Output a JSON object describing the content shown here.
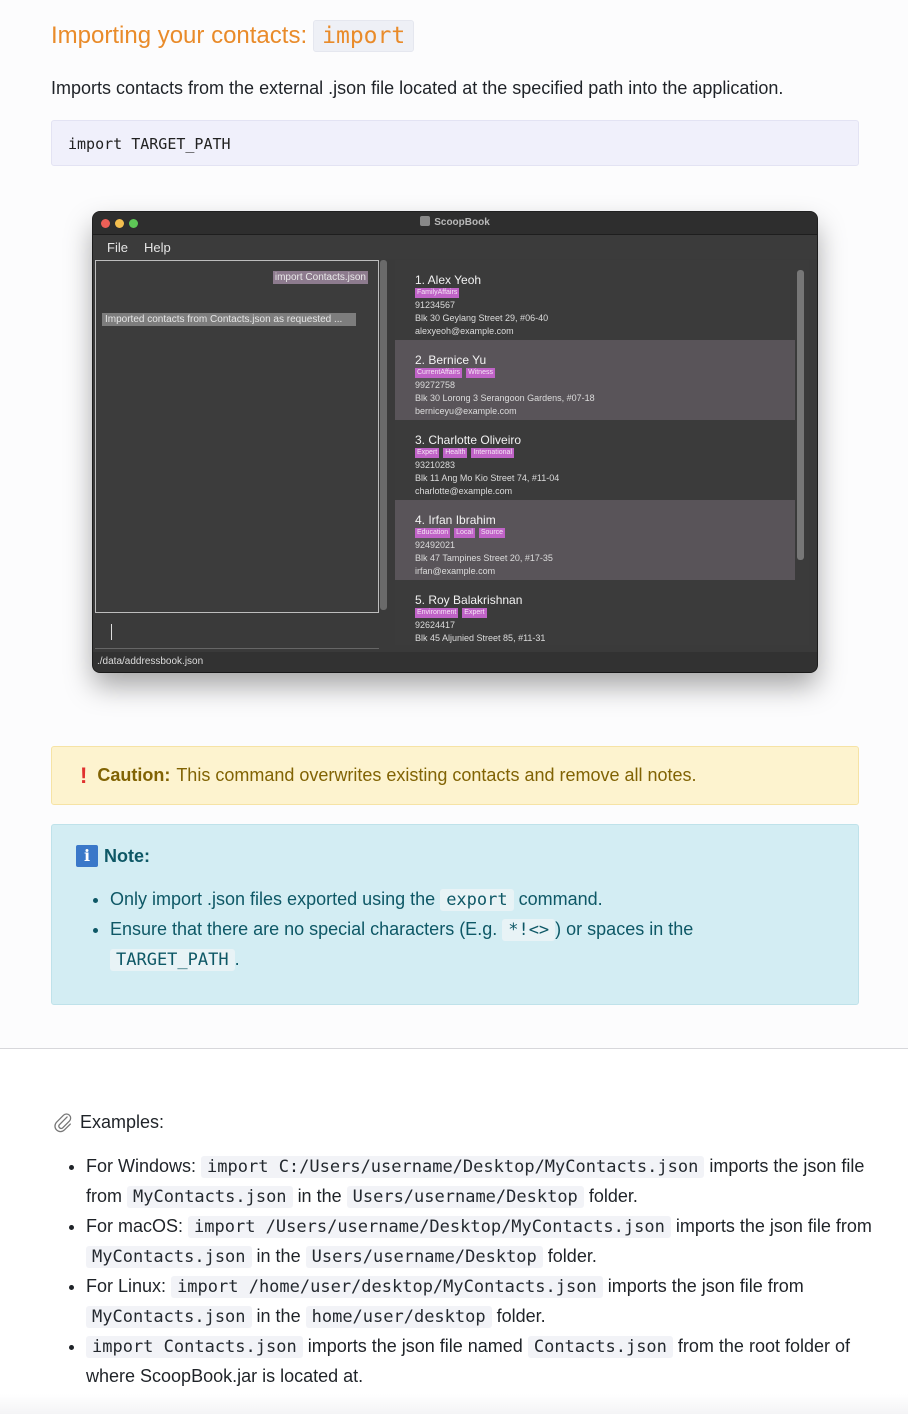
{
  "section": {
    "title_text": "Importing your contacts:",
    "title_code": "import",
    "intro": "Imports contacts from the external .json file located at the specified path into the application.",
    "syntax": "import TARGET_PATH"
  },
  "app_window": {
    "title": "ScoopBook",
    "menu": [
      "File",
      "Help"
    ],
    "command_echo": "import Contacts.json",
    "result_message": "Imported contacts from Contacts.json as requested ...",
    "status_path": "./data/addressbook.json",
    "contacts": [
      {
        "name": "1. Alex Yeoh",
        "tags": [
          "FamilyAffairs"
        ],
        "phone": "91234567",
        "address": "Blk 30 Geylang Street 29, #06-40",
        "email": "alexyeoh@example.com"
      },
      {
        "name": "2. Bernice Yu",
        "tags": [
          "CurrentAffairs",
          "Witness"
        ],
        "phone": "99272758",
        "address": "Blk 30 Lorong 3 Serangoon Gardens, #07-18",
        "email": "berniceyu@example.com"
      },
      {
        "name": "3. Charlotte Oliveiro",
        "tags": [
          "Expert",
          "Health",
          "International"
        ],
        "phone": "93210283",
        "address": "Blk 11 Ang Mo Kio Street 74, #11-04",
        "email": "charlotte@example.com"
      },
      {
        "name": "4. Irfan Ibrahim",
        "tags": [
          "Education",
          "Local",
          "Source"
        ],
        "phone": "92492021",
        "address": "Blk 47 Tampines Street 20, #17-35",
        "email": "irfan@example.com"
      },
      {
        "name": "5. Roy Balakrishnan",
        "tags": [
          "Environment",
          "Expert"
        ],
        "phone": "92624417",
        "address": "Blk 45 Aljunied Street 85, #11-31",
        "email": ""
      }
    ]
  },
  "caution": {
    "label": "Caution:",
    "text": "This command overwrites existing contacts and remove all notes."
  },
  "note": {
    "label": "Note:",
    "item1_pre": "Only import .json files exported using the",
    "item1_code": "export",
    "item1_post": "command.",
    "item2_pre": "Ensure that there are no special characters (E.g.",
    "item2_code": "*!<>",
    "item2_mid": ") or spaces in the",
    "item2_code2": "TARGET_PATH",
    "item2_post": "."
  },
  "examples": {
    "label": "Examples:",
    "windows": {
      "pre": "For Windows:",
      "cmd": "import C:/Users/username/Desktop/MyContacts.json",
      "mid1": "imports the json file from",
      "file": "MyContacts.json",
      "mid2": "in the",
      "folder": "Users/username/Desktop",
      "post": "folder."
    },
    "macos": {
      "pre": "For macOS:",
      "cmd": "import /Users/username/Desktop/MyContacts.json",
      "mid1": "imports the json file from",
      "file": "MyContacts.json",
      "mid2": "in the",
      "folder": "Users/username/Desktop",
      "post": "folder."
    },
    "linux": {
      "pre": "For Linux:",
      "cmd": "import /home/user/desktop/MyContacts.json",
      "mid1": "imports the json file from",
      "file": "MyContacts.json",
      "mid2": "in the",
      "folder": "home/user/desktop",
      "post": "folder."
    },
    "root": {
      "cmd": "import Contacts.json",
      "mid1": "imports the json file named",
      "file": "Contacts.json",
      "post": "from the root folder of where ScoopBook.jar is located at."
    }
  }
}
